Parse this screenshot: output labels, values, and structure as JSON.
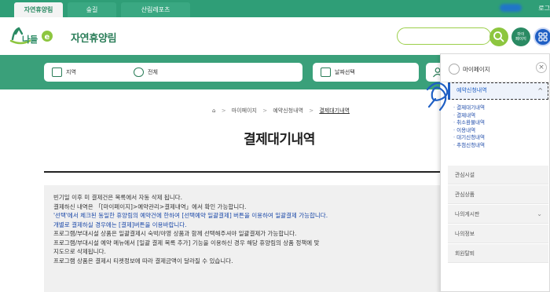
{
  "top_tabs": [
    {
      "label": "자연휴양림",
      "active": true
    },
    {
      "label": "숲길",
      "active": false
    },
    {
      "label": "산림레포츠",
      "active": false
    }
  ],
  "top_user_text": "로그",
  "header": {
    "logo_text": "숲나들e",
    "site_title": "자연휴양림",
    "search_placeholder": "",
    "mypage_btn_line1": "마이",
    "mypage_btn_line2": "페이지"
  },
  "band_fields": [
    {
      "label": "지역",
      "icon": "map-icon"
    },
    {
      "label": "전체",
      "icon": "search-icon"
    },
    {
      "label": "날짜선택",
      "icon": "calendar-icon"
    }
  ],
  "breadcrumb": {
    "home_icon": "home-icon",
    "items": [
      "마이페이지",
      "예약신청내역",
      "결제대기내역"
    ]
  },
  "page_title": "결제대기내역",
  "info_lines": [
    {
      "text": "빈기일 이후 미 결제건은 목록에서 자동 삭제 됩니다.",
      "blue": false
    },
    {
      "text": "결제하신 내역은 「[마이페이지]>예약관리>결제내역」에서 확인 가능합니다.",
      "blue": false
    },
    {
      "text": "'선택'에서 체크된 동일한 휴양림의 예약건에 한하여 [선택예약 일괄결제] 버튼을 이용하여 일괄결제 가능합니다.",
      "blue": true
    },
    {
      "text": "개별로 결제하실 경우에는 [결제]버튼을 이용바랍니다.",
      "blue": true
    },
    {
      "text": "프로그램/부대시설 상품은 일괄결제시 숙박/야영 상품과 함께 선택해주셔야 일괄결제가 가능합니다.",
      "blue": false
    },
    {
      "text": "프로그램/부대시설 예약 메뉴에서 [일괄 결제 목록 추가] 기능을 이용하신 경우 해당 휴양림의 상품 정책에 맞",
      "blue": false
    },
    {
      "text": "지도으로 삭제됩니다.",
      "blue": false
    },
    {
      "text": "프로그램 상품은 결제시 티켓정보에 따라 결제금액이 달라질 수 있습니다.",
      "blue": false
    }
  ],
  "panel": {
    "title": "마이페이지",
    "close_icon": "close-icon",
    "selected": "예약신청내역",
    "sub_items": [
      "결제대기내역",
      "결제내역",
      "취소환불내역",
      "이용내역",
      "대기신청내역",
      "추첨신청내역"
    ],
    "items": [
      {
        "label": "관심시설",
        "chevron": false
      },
      {
        "label": "관심상품",
        "chevron": false
      },
      {
        "label": "나의게시판",
        "chevron": true
      },
      {
        "label": "나의정보",
        "chevron": false
      },
      {
        "label": "회원탈퇴",
        "chevron": false
      }
    ]
  },
  "colors": {
    "brand_green": "#3aa07a",
    "dark_green": "#2a7d58",
    "accent_blue": "#1f5fc4",
    "lime": "#8dc63f"
  }
}
